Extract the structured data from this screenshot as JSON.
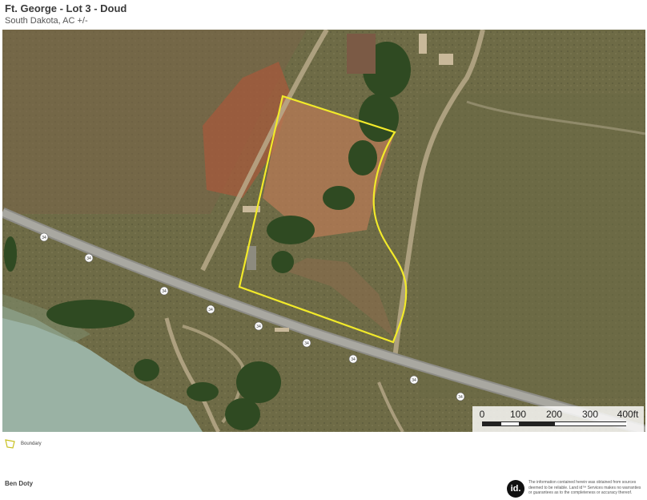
{
  "header": {
    "title": "Ft. George - Lot 3 - Doud",
    "subtitle": "South Dakota,  AC +/-"
  },
  "map": {
    "highway_shield_label": "34",
    "boundary_color": "#f2ea2a",
    "imagery": "satellite"
  },
  "scale": {
    "labels": [
      "0",
      "100",
      "200",
      "300",
      "400ft"
    ]
  },
  "legend": {
    "label": "Boundary",
    "icon": "boundary-polygon-icon"
  },
  "footer": {
    "agent_name": "Ben Doty",
    "logo_text": "id.",
    "disclaimer": "The information contained herein was obtained from sources deemed to be reliable. Land id™ Services makes no warranties or guarantees as to the completeness or accuracy thereof."
  }
}
